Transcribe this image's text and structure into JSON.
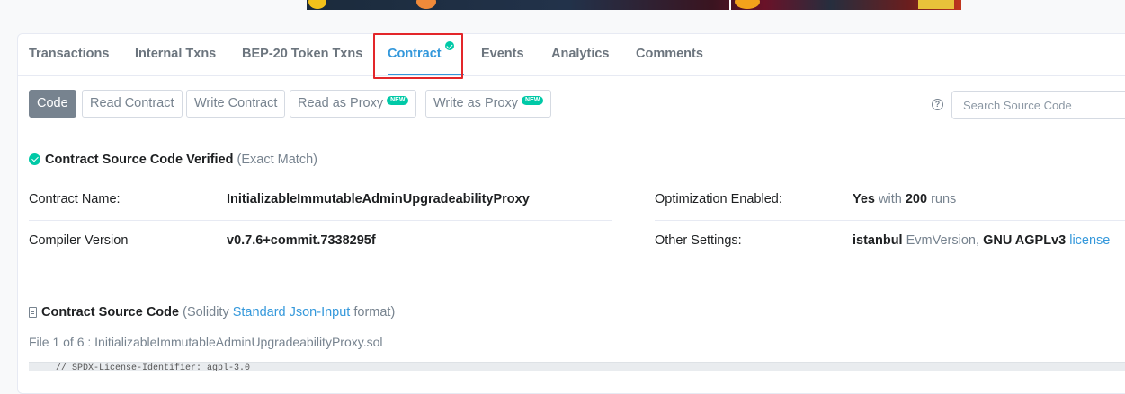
{
  "tabs": [
    {
      "label": "Transactions"
    },
    {
      "label": "Internal Txns"
    },
    {
      "label": "BEP-20 Token Txns"
    },
    {
      "label": "Contract",
      "active": true,
      "verified": true
    },
    {
      "label": "Events"
    },
    {
      "label": "Analytics"
    },
    {
      "label": "Comments"
    }
  ],
  "subtabs": {
    "code": "Code",
    "read_contract": "Read Contract",
    "write_contract": "Write Contract",
    "read_proxy": "Read as Proxy",
    "write_proxy": "Write as Proxy",
    "new_badge": "NEW"
  },
  "search": {
    "placeholder": "Search Source Code",
    "help": "?"
  },
  "verified": {
    "title": "Contract Source Code Verified",
    "match": "(Exact Match)"
  },
  "info": {
    "contract_name_label": "Contract Name:",
    "contract_name": "InitializableImmutableAdminUpgradeabilityProxy",
    "compiler_label": "Compiler Version",
    "compiler": "v0.7.6+commit.7338295f",
    "optimization_label": "Optimization Enabled:",
    "optimization_yes": "Yes",
    "optimization_with": "with",
    "optimization_runs": "200",
    "optimization_runs_word": "runs",
    "other_label": "Other Settings:",
    "other_evm": "istanbul",
    "other_evm_word": "EvmVersion,",
    "other_license": "GNU AGPLv3",
    "other_license_link": "license"
  },
  "source": {
    "title": "Contract Source Code",
    "prefix": "(Solidity",
    "link": "Standard Json-Input",
    "suffix": "format)",
    "file_line": "File 1 of 6 : InitializableImmutableAdminUpgradeabilityProxy.sol",
    "code_preview": "// SPDX-License-Identifier: agpl-3.0"
  },
  "colors": {
    "accent": "#3498db",
    "verified": "#00c9a7",
    "highlight": "#e3262a"
  }
}
